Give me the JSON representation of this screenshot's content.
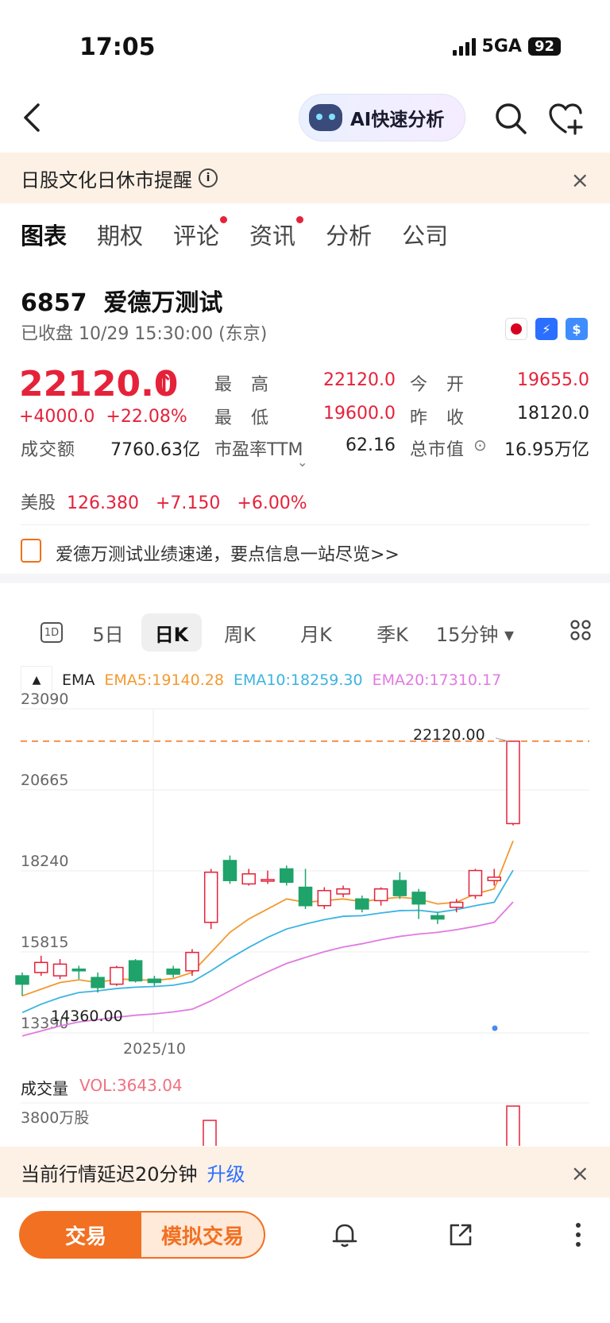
{
  "status_bar": {
    "time": "17:05",
    "network": "5GA",
    "battery": "92"
  },
  "nav": {
    "ai_label": "AI快速分析"
  },
  "notice_top": {
    "text": "日股文化日休市提醒",
    "info": "i",
    "close": "×"
  },
  "tabs": [
    {
      "label": "图表",
      "active": true,
      "dot": false
    },
    {
      "label": "期权",
      "active": false,
      "dot": false
    },
    {
      "label": "评论",
      "active": false,
      "dot": true
    },
    {
      "label": "资讯",
      "active": false,
      "dot": true
    },
    {
      "label": "分析",
      "active": false,
      "dot": false
    },
    {
      "label": "公司",
      "active": false,
      "dot": false
    }
  ],
  "stock": {
    "code": "6857",
    "name": "爱德万测试",
    "status": "已收盘 10/29 15:30:00 (东京)",
    "price": "22120.0",
    "change": "+4000.0",
    "change_pct": "+22.08%",
    "stats": {
      "high_label": "最　高",
      "high": "22120.0",
      "open_label": "今　开",
      "open": "19655.0",
      "low_label": "最　低",
      "low": "19600.0",
      "prev_label": "昨　收",
      "prev": "18120.0",
      "turnover_label": "成交额",
      "turnover": "7760.63亿",
      "pe_label": "市盈率TTM",
      "pe": "62.16",
      "mcap_label": "总市值",
      "mcap": "16.95万亿"
    },
    "us": {
      "label": "美股",
      "price": "126.380",
      "change": "+7.150",
      "change_pct": "+6.00%"
    },
    "report_text": "爱德万测试业绩速递，要点信息一站尽览>>"
  },
  "period_tabs": [
    "1D",
    "5日",
    "日K",
    "周K",
    "月K",
    "季K",
    "15分钟 ▾"
  ],
  "active_period": "日K",
  "ema": {
    "label": "EMA",
    "ema5": "EMA5:19140.28",
    "ema10": "EMA10:18259.30",
    "ema20": "EMA20:17310.17",
    "colors": {
      "ema5": "#f29a30",
      "ema10": "#3cb4e0",
      "ema20": "#e07ae0",
      "up": "#e5223a",
      "down": "#1fa36a"
    }
  },
  "chart_data": {
    "type": "candlestick",
    "y_ticks": [
      "23090",
      "20665",
      "18240",
      "15815",
      "13390"
    ],
    "ylim": [
      13390,
      23090
    ],
    "x_label": "2025/10",
    "max_label": "22120.00",
    "min_label": "14360.00",
    "reference_line": 22120,
    "candles": [
      {
        "o": 15100,
        "c": 14850,
        "h": 15200,
        "l": 14500
      },
      {
        "o": 15200,
        "c": 15500,
        "h": 15700,
        "l": 15100
      },
      {
        "o": 15100,
        "c": 15450,
        "h": 15600,
        "l": 15000
      },
      {
        "o": 15300,
        "c": 15250,
        "h": 15400,
        "l": 15000
      },
      {
        "o": 15050,
        "c": 14750,
        "h": 15200,
        "l": 14600
      },
      {
        "o": 14850,
        "c": 15350,
        "h": 15400,
        "l": 14800
      },
      {
        "o": 15550,
        "c": 14950,
        "h": 15600,
        "l": 14900
      },
      {
        "o": 15000,
        "c": 14900,
        "h": 15100,
        "l": 14800
      },
      {
        "o": 15300,
        "c": 15150,
        "h": 15400,
        "l": 15050
      },
      {
        "o": 15250,
        "c": 15800,
        "h": 15900,
        "l": 15100
      },
      {
        "o": 16700,
        "c": 18200,
        "h": 18300,
        "l": 16500
      },
      {
        "o": 18550,
        "c": 17950,
        "h": 18700,
        "l": 17850
      },
      {
        "o": 17850,
        "c": 18150,
        "h": 18300,
        "l": 17800
      },
      {
        "o": 17950,
        "c": 17980,
        "h": 18250,
        "l": 17850
      },
      {
        "o": 18300,
        "c": 17900,
        "h": 18400,
        "l": 17800
      },
      {
        "o": 17750,
        "c": 17200,
        "h": 18300,
        "l": 17100
      },
      {
        "o": 17200,
        "c": 17650,
        "h": 17750,
        "l": 17100
      },
      {
        "o": 17550,
        "c": 17700,
        "h": 17800,
        "l": 17450
      },
      {
        "o": 17400,
        "c": 17100,
        "h": 17500,
        "l": 17000
      },
      {
        "o": 17350,
        "c": 17700,
        "h": 17750,
        "l": 17200
      },
      {
        "o": 17950,
        "c": 17500,
        "h": 18200,
        "l": 17400
      },
      {
        "o": 17600,
        "c": 17250,
        "h": 17700,
        "l": 16800
      },
      {
        "o": 16900,
        "c": 16800,
        "h": 17000,
        "l": 16650
      },
      {
        "o": 17150,
        "c": 17300,
        "h": 17400,
        "l": 17000
      },
      {
        "o": 17500,
        "c": 18250,
        "h": 18300,
        "l": 17400
      },
      {
        "o": 17950,
        "c": 18050,
        "h": 18300,
        "l": 17800
      },
      {
        "o": 19655,
        "c": 22120,
        "h": 22120,
        "l": 19600
      }
    ],
    "ema5": [
      14500,
      14700,
      14900,
      14980,
      14900,
      15000,
      14990,
      14960,
      15020,
      15200,
      15800,
      16400,
      16800,
      17100,
      17400,
      17300,
      17350,
      17400,
      17320,
      17400,
      17450,
      17400,
      17250,
      17300,
      17550,
      17700,
      19140
    ],
    "ema10": [
      14000,
      14250,
      14450,
      14600,
      14650,
      14720,
      14760,
      14780,
      14820,
      14920,
      15250,
      15620,
      15950,
      16250,
      16500,
      16650,
      16780,
      16880,
      16900,
      16980,
      17050,
      17060,
      17000,
      17080,
      17200,
      17300,
      18259
    ],
    "ema20": [
      13300,
      13450,
      13600,
      13720,
      13790,
      13860,
      13920,
      13960,
      14020,
      14100,
      14350,
      14650,
      14950,
      15220,
      15470,
      15650,
      15820,
      15960,
      16060,
      16180,
      16280,
      16350,
      16400,
      16480,
      16580,
      16700,
      17310
    ],
    "volume": {
      "label": "成交量",
      "value": "VOL:3643.04",
      "axis": "3800万股"
    }
  },
  "notice_bottom": {
    "text": "当前行情延迟20分钟",
    "link": "升级",
    "close": "×"
  },
  "bottom_bar": {
    "trade": "交易",
    "sim_trade": "模拟交易"
  }
}
